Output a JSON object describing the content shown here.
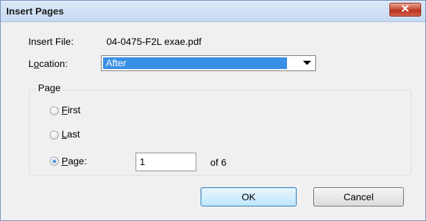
{
  "window": {
    "title": "Insert Pages",
    "close_symbol": "✕"
  },
  "insert_file": {
    "label": "Insert File:",
    "value": "04-0475-F2L exae.pdf"
  },
  "location": {
    "label_before": "L",
    "label_mnemonic": "o",
    "label_after": "cation:",
    "selected": "After"
  },
  "page_group": {
    "title": "Page",
    "options": [
      {
        "mnemonic": "F",
        "rest": "irst",
        "checked": false
      },
      {
        "mnemonic": "L",
        "rest": "ast",
        "checked": false
      },
      {
        "mnemonic": "P",
        "rest": "age:",
        "checked": true
      }
    ],
    "page_value": "1",
    "of_text": "of 6"
  },
  "buttons": {
    "ok": "OK",
    "cancel": "Cancel"
  }
}
